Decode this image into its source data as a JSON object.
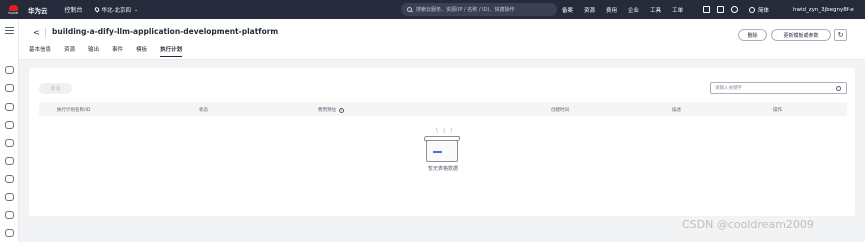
{
  "topbar": {
    "logo_text": "HUAWEI",
    "brand": "华为云",
    "console": "控制台",
    "region": "华北-北京四",
    "search_placeholder": "搜索云服务、资源(IP / 名称 / ID)、快捷操作",
    "nav": [
      "备案",
      "资源",
      "费用",
      "企业",
      "工具",
      "工单"
    ],
    "lang": "简体",
    "user": "hwid_zyn_3jbegny8f-e"
  },
  "header": {
    "back": "<",
    "title": "building-a-dify-llm-application-development-platform",
    "tabs": [
      "基本信息",
      "资源",
      "输出",
      "事件",
      "模板",
      "执行计划"
    ],
    "active_tab": "执行计划",
    "delete_label": "删除",
    "update_label": "更新模板或参数",
    "refresh_symbol": "↻"
  },
  "panel": {
    "cancel_label": "取消",
    "keyword_placeholder": "请输入关键字",
    "columns": [
      "执行计划名称/ID",
      "状态",
      "费用预估",
      "创建时间",
      "描述",
      "操作"
    ],
    "empty_text": "暂无表格数据"
  },
  "watermark": "CSDN @cooldream2009"
}
